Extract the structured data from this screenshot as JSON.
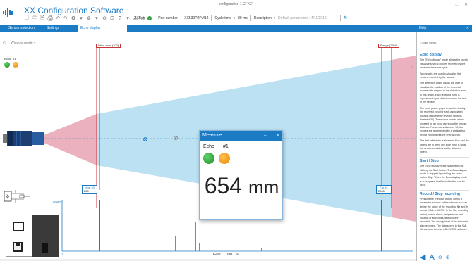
{
  "window": {
    "title": "configuration 1.CFXE*",
    "controls": [
      "–",
      "▭",
      "✕"
    ]
  },
  "app": {
    "title": "XX Configuration Software"
  },
  "toolbar": {
    "items": [
      "🗋",
      "🗁",
      "🗎",
      "🖨",
      "↶",
      "↷",
      "⚙",
      "▾",
      "⊕",
      "▾",
      "⊙",
      "⊡",
      "?",
      "▾",
      "⚠",
      "⚠"
    ]
  },
  "status": {
    "device": "XXBox",
    "part_number_label": "Part number",
    "part_number": "XX530P2PM12",
    "cycle_time_label": "Cycle time",
    "cycle_time": "30 ms",
    "description_label": "Description",
    "description_placeholder": "Default parameters 14/11/2016"
  },
  "tabs": [
    {
      "label": "Sensor selection",
      "active": false
    },
    {
      "label": "Settings",
      "active": false
    },
    {
      "label": "Echo display",
      "active": true
    }
  ],
  "help": {
    "header": "Help",
    "close": "✕",
    "home": "Main menu",
    "sections": [
      {
        "title": "Echo display",
        "paragraphs": [
          "The \"Echo display\" mode allows the user to visualize several echoes received by the sensor in the same cycle.",
          "Two graphs are used to visualize the echoes received by the sensor.",
          "The detection graph allows the user to visualize the position of the received echoes with respect to the detection zone. In this graph, each received echo is represented by a circled cross on the axis of the sensor.",
          "The echo power graph is used to display the received echo for each associated position (and energy level for sensors diameter 30). The mouse pointer when hovered on an echo can show the precise distance. For sensors diameter 30, the echoes are represented by a vertical bar whose height gives the energy level.",
          "The first valid echo is shown in blue and the others are in grey. The Blue echo is what the sensor considers as the detected object."
        ]
      },
      {
        "title": "Start / Stop",
        "paragraphs": [
          "The Echo display mode is activated by clicking the Start button. The Echo display mode is stopped by clicking the same button Stop. When the Echo display mode is in progress, the Record button can be used."
        ]
      },
      {
        "title": "Record / Stop recording",
        "paragraphs": [
          "Pressing the \"Record\" button opens a parameter window. In this window you can define the name of the recording file and its format (XML or XLSX). In the file, recording period, output status, temperature and position of all echoes detected are recorded. The energy level of the echoes is also recorded. The data stored in the XML file can also be read with EXCEL software."
        ]
      }
    ],
    "nav": {
      "back": "◀",
      "font": "A",
      "zoom_out": "⊖",
      "zoom_in": "⊕"
    }
  },
  "main": {
    "window_mode": "Window mode",
    "echo_label": "Echo",
    "echo_number": "#1",
    "blind_zone_label": "Blind zone (200)",
    "range_label": "Range (2500)",
    "near_label": "Near #1",
    "near_value": "220",
    "far_label": "Far #1",
    "far_value": "2000",
    "power_label": "power",
    "zero_label": "0",
    "gain_label": "Gain :",
    "gain_value": "100",
    "gain_unit": "%"
  },
  "measure": {
    "title": "Measure",
    "echo_label": "Echo",
    "echo_number": "#1",
    "value": "654",
    "unit": "mm",
    "controls": [
      "–",
      "□",
      "✕"
    ]
  },
  "colors": {
    "accent": "#1b7bc4",
    "blind_zone": "#e8a3b4",
    "detection_zone": "#9ed4ec",
    "echo_green": "#2e9c3c",
    "echo_orange": "#f2a21c"
  }
}
